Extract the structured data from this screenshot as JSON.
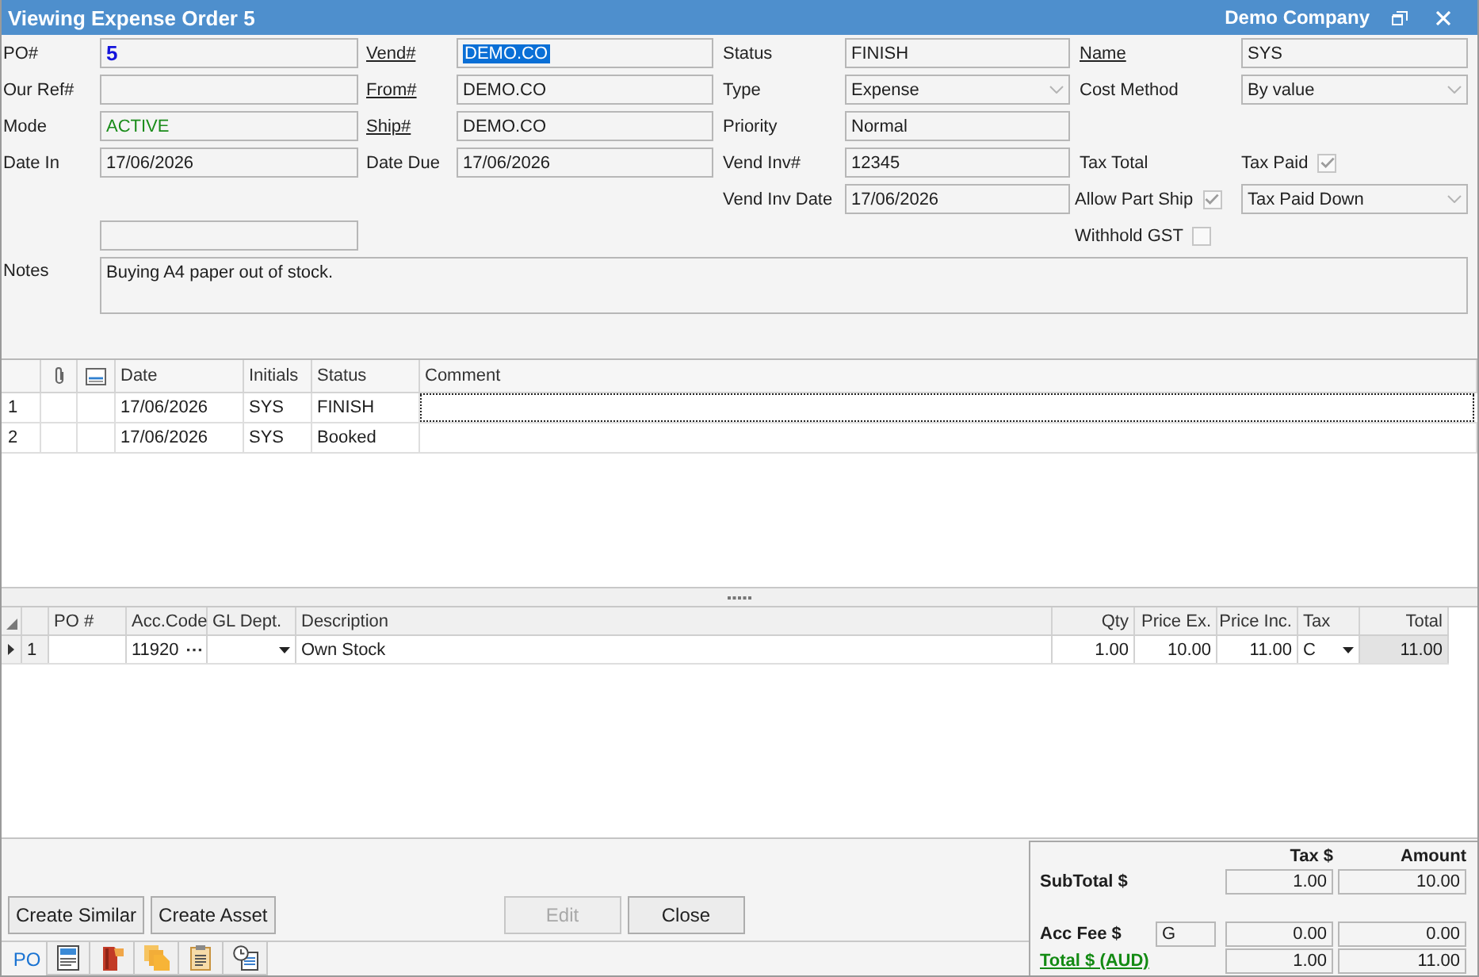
{
  "window": {
    "title": "Viewing Expense Order 5",
    "company": "Demo Company"
  },
  "form": {
    "fields": [
      {
        "kind": "id",
        "label": "PO#",
        "link": false,
        "value": "5"
      },
      {
        "kind": "text",
        "label": "Vend#",
        "link": true,
        "value": "DEMO.CO",
        "highlighted": true
      },
      {
        "kind": "text",
        "label": "Status",
        "link": false,
        "value": "FINISH",
        "highlighted": false
      },
      {
        "kind": "text",
        "label": "Name",
        "link": true,
        "value": "SYS",
        "highlighted": false
      },
      {
        "kind": "text",
        "label": "Our Ref#",
        "link": false
      },
      {
        "kind": "text",
        "label": "From#",
        "link": true,
        "value": "DEMO.CO",
        "highlighted": false
      },
      {
        "kind": "dropdown",
        "label": "Type",
        "link": false,
        "value": "Expense"
      },
      {
        "kind": "dropdown",
        "label": "Cost Method",
        "link": false,
        "value": "By value"
      },
      {
        "kind": "text",
        "label": "Mode",
        "link": false,
        "value": "ACTIVE",
        "color": "#1a8c1a",
        "highlighted": false
      },
      {
        "kind": "text",
        "label": "Ship#",
        "link": true,
        "value": "DEMO.CO",
        "highlighted": false
      },
      {
        "kind": "text",
        "label": "Priority",
        "link": false,
        "value": "Normal",
        "highlighted": false
      },
      {
        "kind": "text",
        "label": "Date In",
        "link": false,
        "value": "17/06/2026",
        "highlighted": false
      },
      {
        "kind": "text",
        "label": "Date Due",
        "link": false,
        "value": "17/06/2026",
        "highlighted": false
      },
      {
        "kind": "text",
        "label": "Vend Inv#",
        "link": false,
        "value": "12345",
        "highlighted": false
      },
      {
        "kind": "caption",
        "label": "Tax Total"
      },
      {
        "kind": "checkbox",
        "label": "Tax Paid",
        "checked": true
      },
      {
        "kind": "text",
        "label": "Vend Inv Date",
        "link": false,
        "value": "17/06/2026",
        "highlighted": false
      },
      {
        "kind": "checkbox",
        "label": "Allow Part Ship",
        "checked": true
      },
      {
        "kind": "dropdown",
        "value": "Tax Paid Down"
      },
      {
        "kind": "text"
      },
      {
        "kind": "checkbox",
        "label": "Withhold GST",
        "checked": false
      },
      {
        "kind": "memo",
        "label": "Notes",
        "link": false,
        "value": "Buying A4 paper out of stock."
      }
    ]
  },
  "history": {
    "columns": [
      "Date",
      "Initials",
      "Status",
      "Comment"
    ],
    "rows": [
      {
        "number": "1",
        "date": "17/06/2026",
        "initials": "SYS",
        "status": "FINISH",
        "focused": true
      },
      {
        "number": "2",
        "date": "17/06/2026",
        "initials": "SYS",
        "status": "Booked",
        "focused": false
      }
    ]
  },
  "lines": {
    "columns": [
      "PO #",
      "Acc.Code",
      "GL Dept.",
      "Description",
      "Qty",
      "Price Ex.",
      "Price Inc.",
      "Tax",
      "Total"
    ],
    "rows": [
      {
        "number": "1",
        "current": true,
        "acc_code": "11920",
        "description": "Own Stock",
        "qty": "1.00",
        "price_ex": "10.00",
        "price_inc": "11.00",
        "tax": "C",
        "total": "11.00"
      }
    ]
  },
  "actions": {
    "left": [
      {
        "label": "Create Similar",
        "disabled": false
      },
      {
        "label": "Create Asset",
        "disabled": false
      }
    ],
    "right": [
      {
        "label": "Edit",
        "disabled": true
      },
      {
        "label": "Close",
        "disabled": false
      }
    ]
  },
  "tabs": [
    {
      "kind": "text",
      "label": "PO",
      "selected": true
    },
    {
      "kind": "icon",
      "selected": false
    },
    {
      "kind": "icon",
      "selected": false
    },
    {
      "kind": "icon",
      "selected": false
    },
    {
      "kind": "icon",
      "selected": false
    },
    {
      "kind": "icon",
      "selected": false
    }
  ],
  "totals": {
    "columns": [
      "Tax $",
      "Amount"
    ],
    "rows": [
      {
        "kind": "subtotal",
        "label": "SubTotal $",
        "tax": "1.00",
        "amount": "10.00"
      },
      {
        "kind": "fee",
        "label": "Acc Fee $",
        "code": "G",
        "tax": "0.00",
        "amount": "0.00"
      },
      {
        "kind": "total",
        "label": "Total $ (AUD)",
        "tax": "1.00",
        "amount": "11.00"
      }
    ]
  }
}
